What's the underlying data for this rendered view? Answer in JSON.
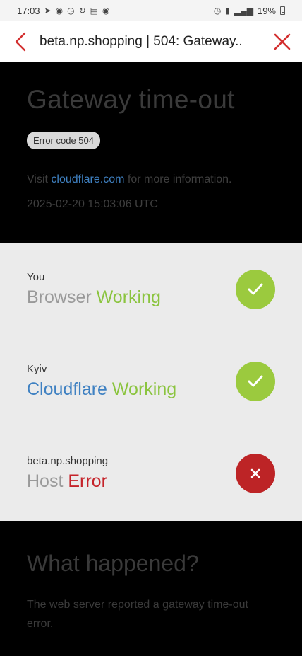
{
  "status_bar": {
    "time": "17:03",
    "battery": "19%"
  },
  "app_bar": {
    "title": "beta.np.shopping | 504: Gateway.."
  },
  "hero": {
    "title": "Gateway time-out",
    "error_badge": "Error code 504",
    "visit_prefix": "Visit ",
    "visit_link": "cloudflare.com",
    "visit_suffix": " for more information.",
    "timestamp": "2025-02-20 15:03:06 UTC"
  },
  "status_rows": [
    {
      "location": "You",
      "name": "Browser",
      "state": "Working",
      "status": "ok"
    },
    {
      "location": "Kyiv",
      "name": "Cloudflare",
      "state": "Working",
      "status": "ok"
    },
    {
      "location": "beta.np.shopping",
      "name": "Host",
      "state": "Error",
      "status": "error"
    }
  ],
  "what_happened": {
    "title": "What happened?",
    "text": "The web server reported a gateway time-out error."
  },
  "colors": {
    "accent_red": "#d32f2f",
    "ok_green": "#9bca3e",
    "error_red": "#bd2426",
    "link_blue": "#3f81c2"
  }
}
